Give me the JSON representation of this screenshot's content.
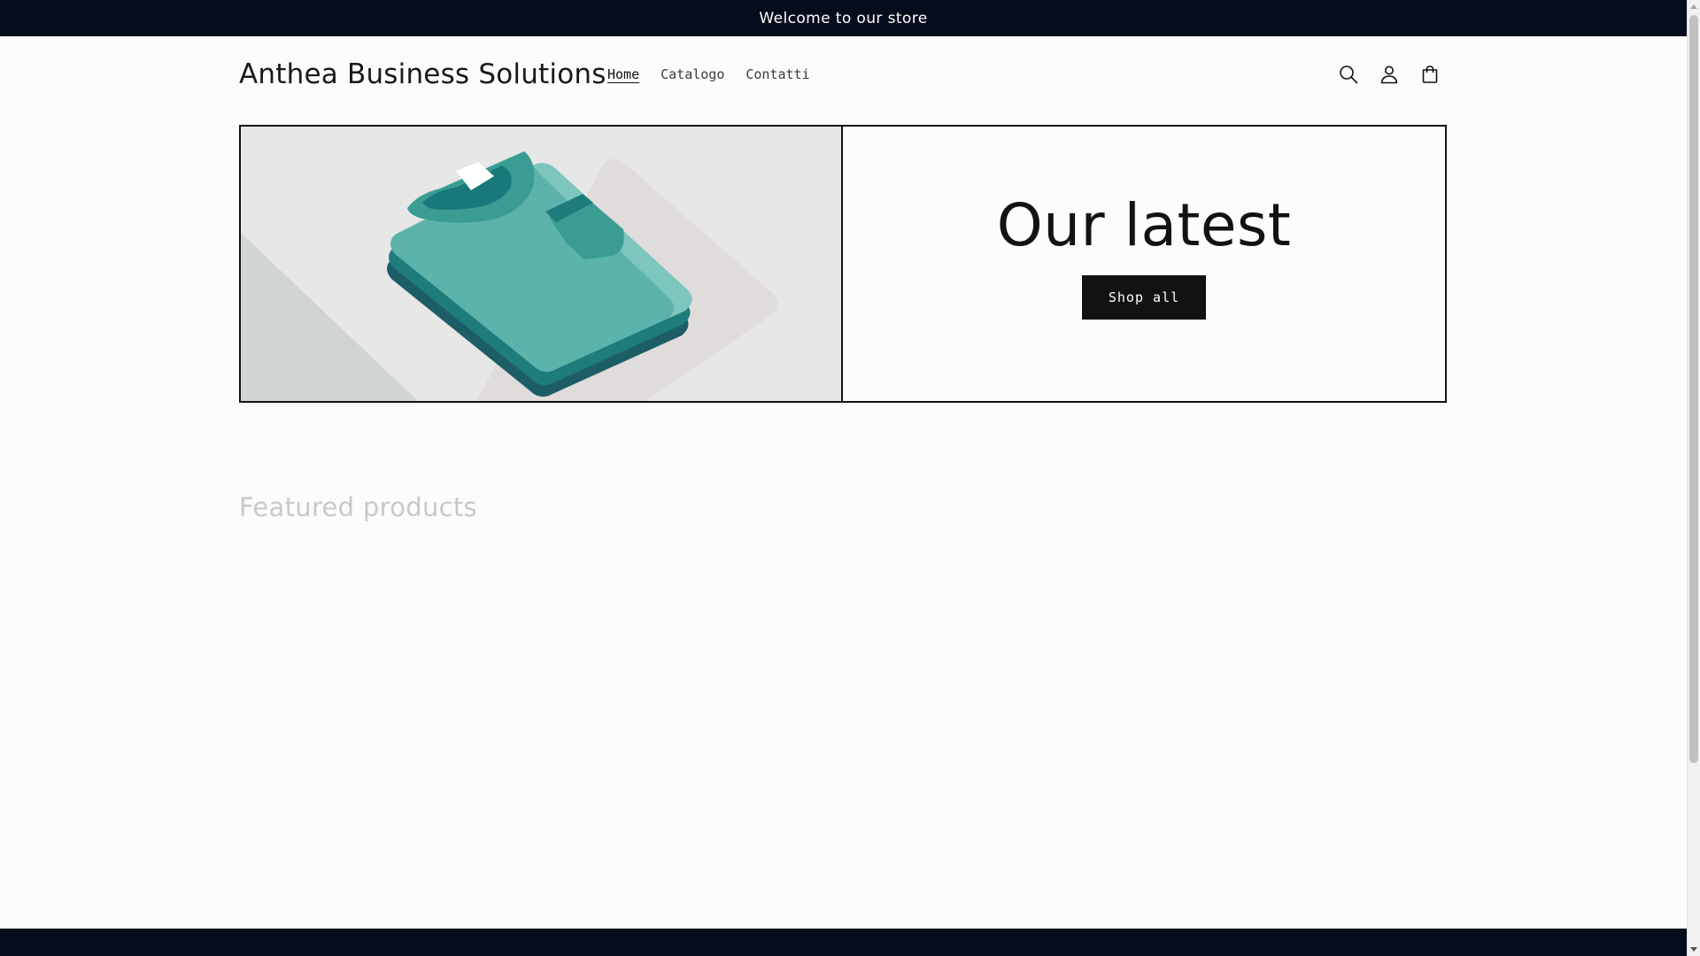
{
  "announcement": {
    "text": "Welcome to our store"
  },
  "header": {
    "logo": "Anthea Business Solutions",
    "nav": [
      {
        "label": "Home",
        "active": true
      },
      {
        "label": "Catalogo",
        "active": false
      },
      {
        "label": "Contatti",
        "active": false
      }
    ],
    "icons": [
      "search-icon",
      "account-icon",
      "cart-icon"
    ]
  },
  "hero": {
    "title": "Our latest",
    "button_label": "Shop all",
    "image": "folded-shirts-illustration"
  },
  "featured": {
    "title": "Featured products"
  },
  "colors": {
    "announcement_bg": "#050c1b",
    "page_bg": "#fcfcfc",
    "button_bg": "#121212",
    "shirt_teal": "#5bb3ab",
    "shirt_dark": "#1d5e66"
  }
}
